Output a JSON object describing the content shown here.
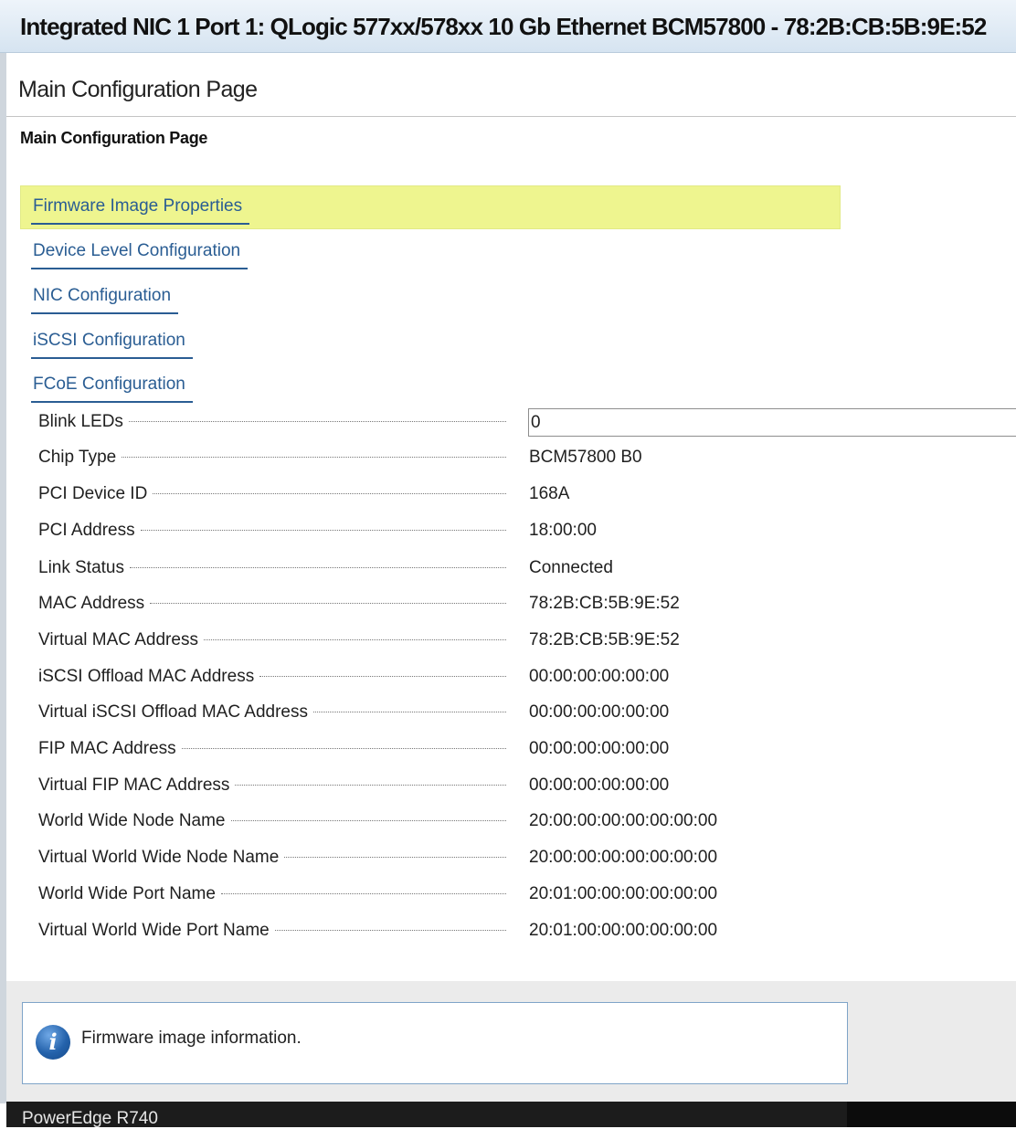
{
  "window": {
    "title": "Integrated NIC 1 Port 1: QLogic 577xx/578xx 10 Gb Ethernet BCM57800 - 78:2B:CB:5B:9E:52"
  },
  "page": {
    "header": "Main Configuration Page",
    "subheader": "Main Configuration Page"
  },
  "nav": {
    "items": [
      {
        "label": "Firmware Image Properties",
        "highlighted": true
      },
      {
        "label": "Device Level Configuration"
      },
      {
        "label": "NIC Configuration"
      },
      {
        "label": "iSCSI Configuration"
      },
      {
        "label": "FCoE Configuration"
      }
    ]
  },
  "fields": [
    {
      "label": "Blink LEDs",
      "value": "0",
      "editable": true
    },
    {
      "label": "Chip Type",
      "value": "BCM57800 B0"
    },
    {
      "label": "PCI Device ID",
      "value": "168A"
    },
    {
      "label": "PCI Address",
      "value": "18:00:00"
    },
    {
      "label": "Link Status",
      "value": "Connected"
    },
    {
      "label": "MAC Address",
      "value": "78:2B:CB:5B:9E:52"
    },
    {
      "label": "Virtual MAC Address",
      "value": "78:2B:CB:5B:9E:52"
    },
    {
      "label": "iSCSI Offload MAC Address",
      "value": "00:00:00:00:00:00"
    },
    {
      "label": "Virtual iSCSI Offload MAC Address",
      "value": "00:00:00:00:00:00"
    },
    {
      "label": "FIP MAC Address",
      "value": "00:00:00:00:00:00"
    },
    {
      "label": "Virtual FIP MAC Address",
      "value": "00:00:00:00:00:00"
    },
    {
      "label": "World Wide Node Name",
      "value": "20:00:00:00:00:00:00:00"
    },
    {
      "label": "Virtual World Wide Node Name",
      "value": "20:00:00:00:00:00:00:00"
    },
    {
      "label": "World Wide Port Name",
      "value": "20:01:00:00:00:00:00:00"
    },
    {
      "label": "Virtual World Wide Port Name",
      "value": "20:01:00:00:00:00:00:00"
    }
  ],
  "help": {
    "icon": "info-icon",
    "icon_glyph": "i",
    "text": "Firmware image information."
  },
  "status_bar": {
    "system": "PowerEdge R740"
  },
  "colors": {
    "link": "#2a5d93",
    "highlight": "#eef58f",
    "title_bar": "#d6e4f1",
    "status_bar": "#1c1c1c"
  }
}
